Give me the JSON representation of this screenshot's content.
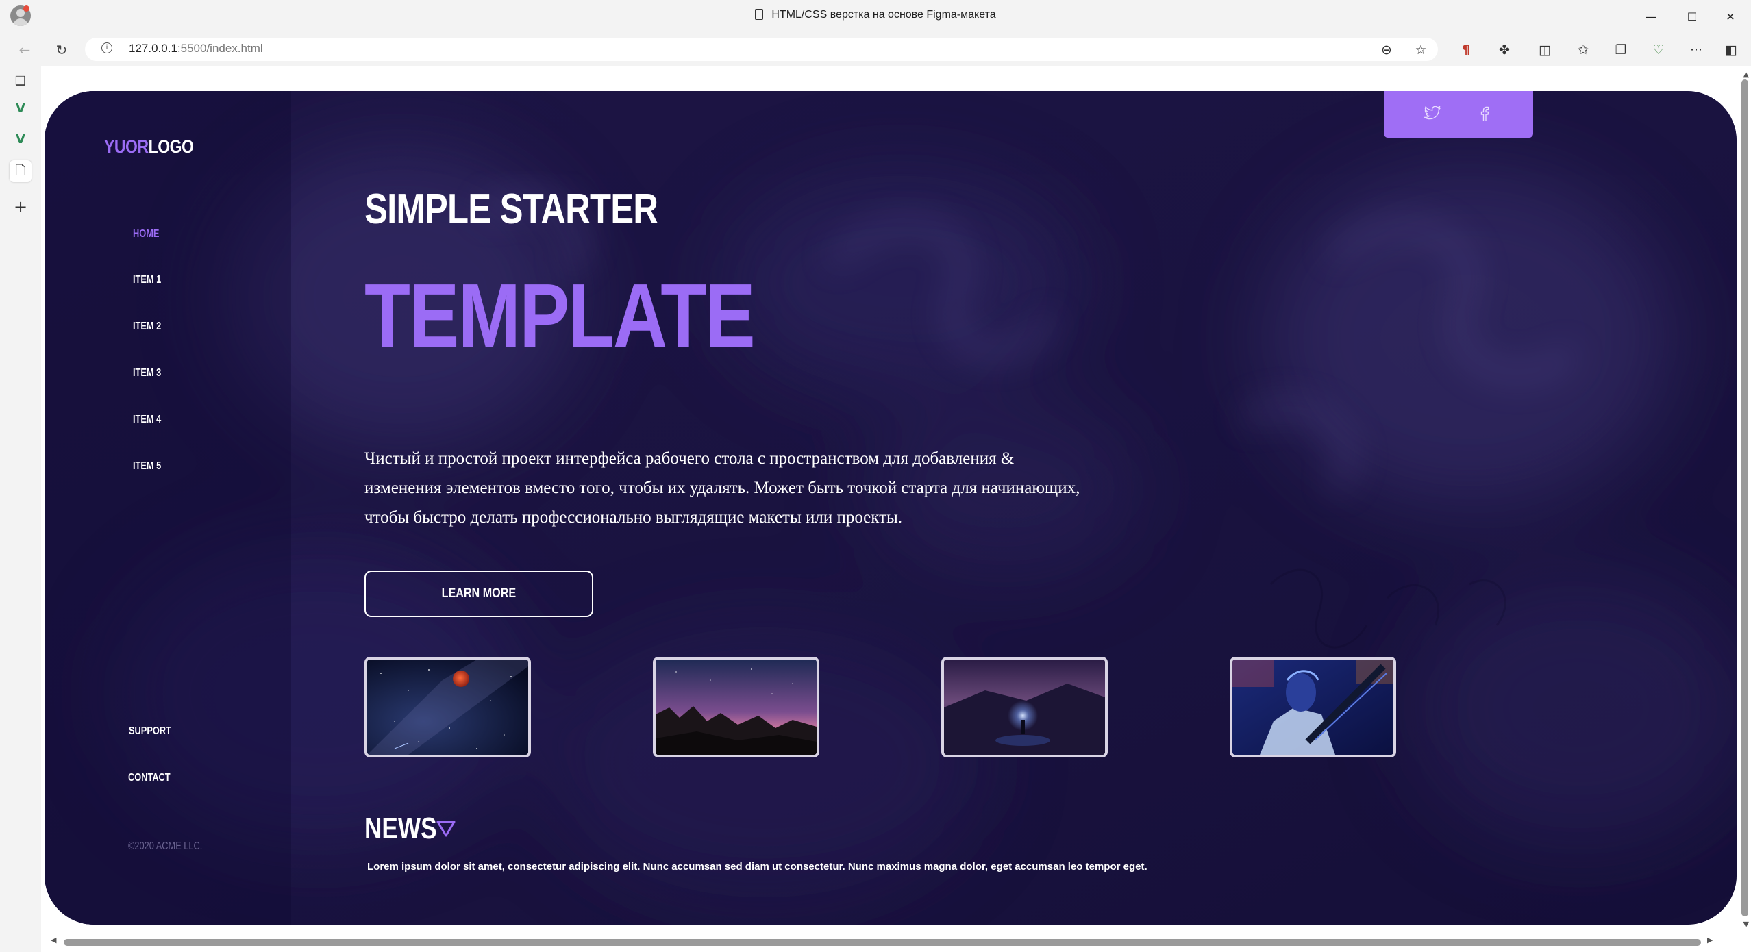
{
  "browser": {
    "tab_title": "HTML/CSS верстка на основе Figma-макета",
    "url_host": "127.0.0.1",
    "url_path": ":5500/index.html"
  },
  "page": {
    "logo": {
      "part1": "YUOR",
      "part2": "LOGO"
    },
    "menu": [
      {
        "label": "HOME",
        "active": true
      },
      {
        "label": "ITEM 1"
      },
      {
        "label": "ITEM 2"
      },
      {
        "label": "ITEM 3"
      },
      {
        "label": "ITEM 4"
      },
      {
        "label": "ITEM 5"
      }
    ],
    "footer_links": [
      {
        "label": "SUPPORT"
      },
      {
        "label": "CONTACT"
      }
    ],
    "copyright": "©2020 ACME LLC.",
    "social": [
      "twitter-icon",
      "facebook-icon"
    ],
    "heading_line1": "SIMPLE STARTER",
    "heading_line2": "TEMPLATE",
    "description": "Чистый и простой проект интерфейса рабочего стола с пространством для добавления & изменения элементов вместо того, чтобы их удалять. Может быть точкой старта для начинающих, чтобы быстро делать профессионально выглядящие макеты или проекты.",
    "learn_more": "LEARN MORE",
    "gallery": [
      "night-sky-with-red-moon",
      "mountains-under-purple-sky",
      "person-with-light-in-dark-field",
      "portrait-in-blue-neon-light"
    ],
    "news_title": "NEWS",
    "news_text": "Lorem ipsum dolor sit amet, consectetur adipiscing elit. Nunc accumsan sed diam ut consectetur. Nunc maximus magna dolor, eget accumsan leo tempor eget."
  },
  "colors": {
    "accent": "#9b6cf5",
    "background": "#1a1340",
    "social_bar": "#9f6ef5"
  }
}
